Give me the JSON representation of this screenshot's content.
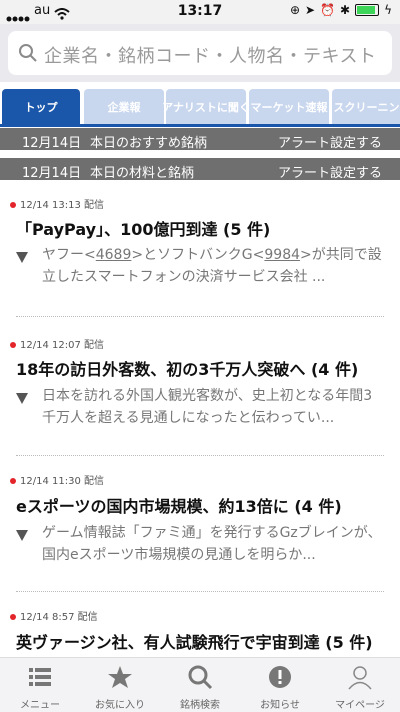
{
  "status": {
    "carrier": "au",
    "time": "13:17"
  },
  "search": {
    "placeholder": "企業名・銘柄コード・人物名・テキスト"
  },
  "tabs": [
    {
      "label": "トップ",
      "active": true
    },
    {
      "label": "企業報"
    },
    {
      "label": "アナリストに聞く"
    },
    {
      "label": "マーケット速報"
    },
    {
      "label": "スクリーニング"
    }
  ],
  "alerts": [
    {
      "date": "12月14日",
      "title": "本日のおすすめ銘柄",
      "action": "アラート設定する"
    },
    {
      "date": "12月14日",
      "title": "本日の材料と銘柄",
      "action": "アラート設定する"
    }
  ],
  "news": [
    {
      "meta": "12/14 13:13 配信",
      "headline": "「PayPay」、100億円到達 (5 件)",
      "summary_pre": "ヤフー<",
      "code1": "4689",
      "summary_mid": ">とソフトバンクG<",
      "code2": "9984",
      "summary_post": ">が共同で設立したスマートフォンの決済サービス会社 ..."
    },
    {
      "meta": "12/14 12:07 配信",
      "headline": "18年の訪日外客数、初の3千万人突破へ (4 件)",
      "summary": "日本を訪れる外国人観光客数が、史上初となる年間3千万人を超える見通しになったと伝わってい..."
    },
    {
      "meta": "12/14 11:30 配信",
      "headline": "eスポーツの国内市場規模、約13倍に (4 件)",
      "summary": "ゲーム情報誌「ファミ通」を発行するGzブレインが、国内eスポーツ市場規模の見通しを明らか..."
    },
    {
      "meta": "12/14 8:57 配信",
      "headline": "英ヴァージン社、有人試験飛行で宇宙到達 (5 件)"
    }
  ],
  "bottom_nav": [
    {
      "label": "メニュー",
      "icon": "menu-icon"
    },
    {
      "label": "お気に入り",
      "icon": "star-icon"
    },
    {
      "label": "銘柄検索",
      "icon": "search-icon"
    },
    {
      "label": "お知らせ",
      "icon": "alert-icon"
    },
    {
      "label": "マイページ",
      "icon": "user-icon"
    }
  ]
}
